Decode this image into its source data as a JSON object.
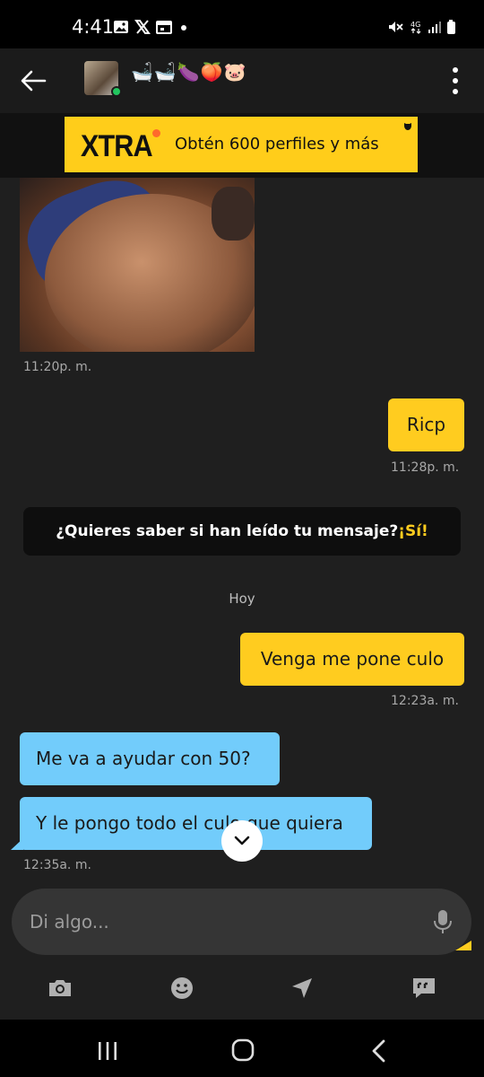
{
  "status_bar": {
    "time": "4:41",
    "icons": [
      "gallery-icon",
      "x-app-icon",
      "calendar-icon",
      "dot-icon",
      "mute-icon",
      "4g-icon",
      "signal-icon",
      "battery-icon"
    ]
  },
  "header": {
    "contact_name": "🛁🛁🍆🍑🐷",
    "online": true
  },
  "ad": {
    "logo": "XTRA",
    "text": "Obtén 600 perfiles y más"
  },
  "messages": {
    "photo_time": "11:20p. m.",
    "m1_text": "Ricp",
    "m1_time": "11:28p. m.",
    "read_banner_text": "¿Quieres saber si han leído tu mensaje?",
    "read_banner_cta": "¡Sí!",
    "day_separator": "Hoy",
    "m2_text": "Venga me pone culo",
    "m2_time": "12:23a. m.",
    "m3_text": "Me va a ayudar con 50?",
    "m4_text": "Y le pongo todo el culo que quiera",
    "m4_time": "12:35a. m."
  },
  "composer": {
    "placeholder": "Di algo..."
  },
  "colors": {
    "outgoing": "#ffcc1f",
    "incoming": "#72ccfb",
    "background": "#1f1f1f"
  }
}
